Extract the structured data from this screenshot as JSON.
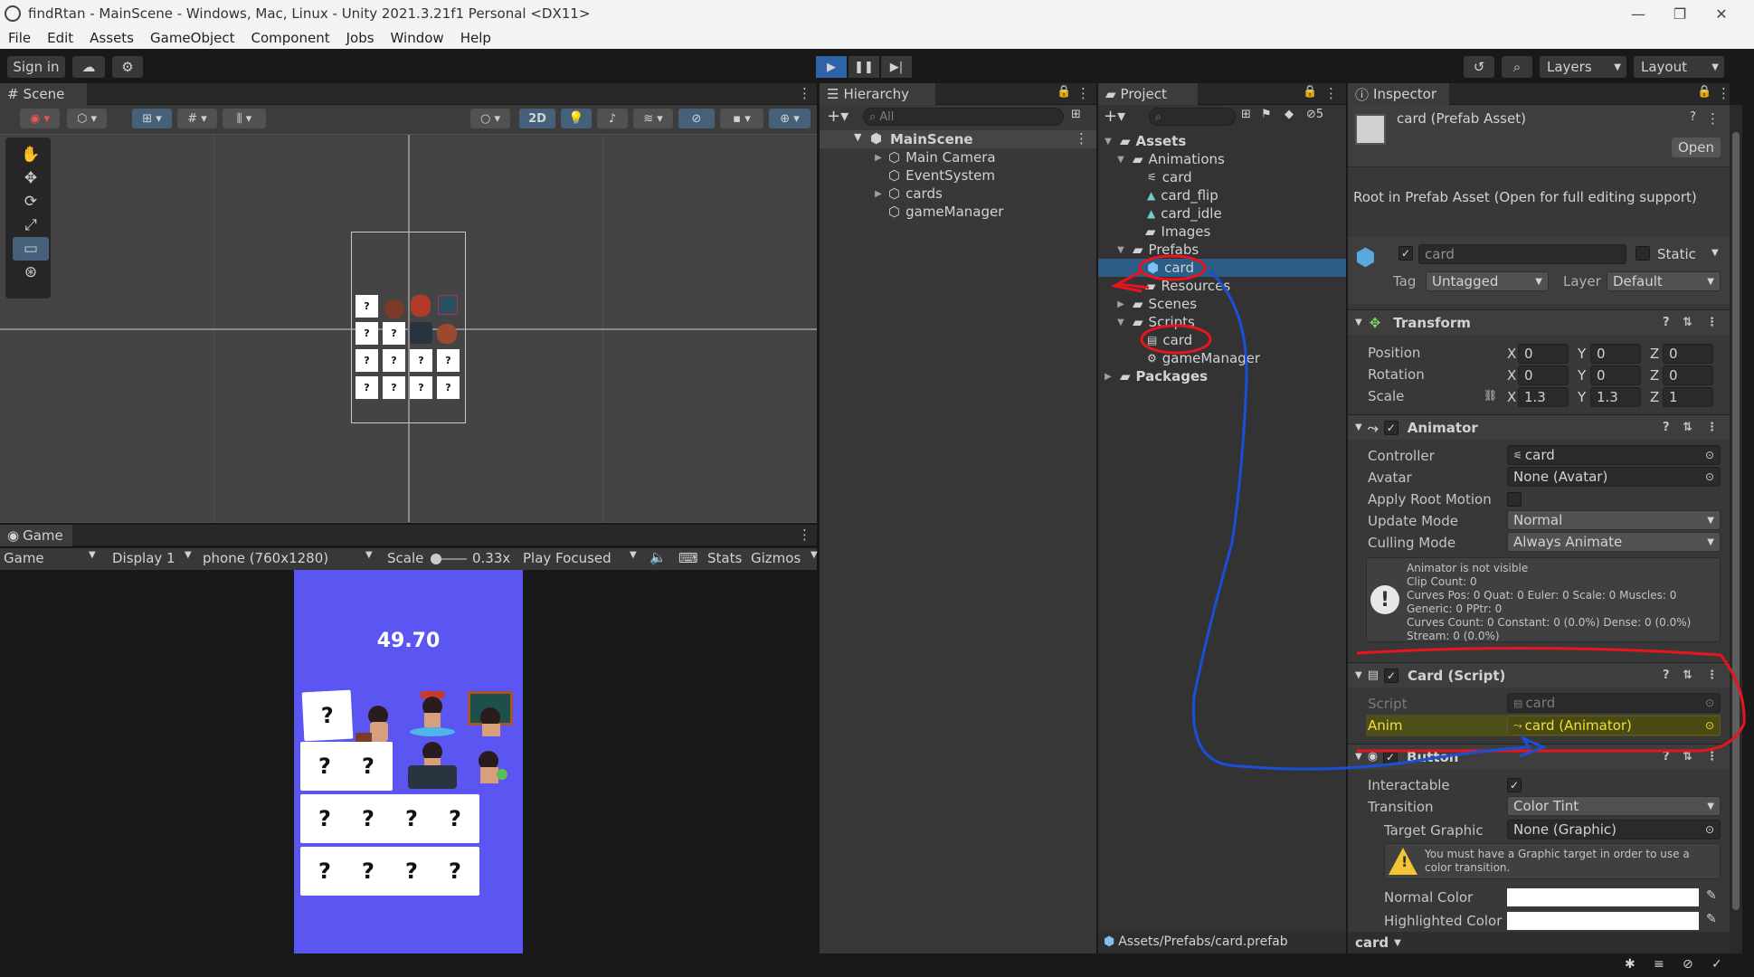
{
  "window": {
    "title": "findRtan - MainScene - Windows, Mac, Linux - Unity 2021.3.21f1 Personal <DX11>",
    "minimize": "—",
    "maximize": "❐",
    "close": "✕"
  },
  "menu": [
    "File",
    "Edit",
    "Assets",
    "GameObject",
    "Component",
    "Jobs",
    "Window",
    "Help"
  ],
  "toolbar": {
    "sign_in": "Sign in",
    "layers": "Layers",
    "layout": "Layout",
    "play_mode_active": true
  },
  "scene": {
    "tab": "Scene",
    "mode_2d": "2D"
  },
  "game": {
    "tab": "Game",
    "view": "Game",
    "display": "Display 1",
    "resolution": "phone (760x1280)",
    "scale_label": "Scale",
    "scale_value": "0.33x",
    "play_focused": "Play Focused",
    "stats": "Stats",
    "gizmos": "Gizmos",
    "timer": "49.70",
    "card_face": "?"
  },
  "hierarchy": {
    "tab": "Hierarchy",
    "search_placeholder": "All",
    "scene": "MainScene",
    "items": [
      "Main Camera",
      "EventSystem",
      "cards",
      "gameManager"
    ]
  },
  "project": {
    "tab": "Project",
    "hidden_count": "5",
    "assets": "Assets",
    "animations": "Animations",
    "anim_items": [
      "card",
      "card_flip",
      "card_idle"
    ],
    "images": "Images",
    "prefabs": "Prefabs",
    "prefab_card": "card",
    "resources": "Resources",
    "scenes": "Scenes",
    "scripts": "Scripts",
    "script_items": [
      "card",
      "gameManager"
    ],
    "packages": "Packages",
    "path": "Assets/Prefabs/card.prefab"
  },
  "inspector": {
    "tab": "Inspector",
    "asset_title": "card (Prefab Asset)",
    "open_button": "Open",
    "root_notice": "Root in Prefab Asset (Open for full editing support)",
    "name_field": "card",
    "static_label": "Static",
    "tag_label": "Tag",
    "tag_value": "Untagged",
    "layer_label": "Layer",
    "layer_value": "Default",
    "transform": {
      "title": "Transform",
      "position_label": "Position",
      "rotation_label": "Rotation",
      "scale_label": "Scale",
      "axis_x": "X",
      "axis_y": "Y",
      "axis_z": "Z",
      "position": [
        "0",
        "0",
        "0"
      ],
      "rotation": [
        "0",
        "0",
        "0"
      ],
      "scale": [
        "1.3",
        "1.3",
        "1"
      ]
    },
    "animator": {
      "title": "Animator",
      "controller_label": "Controller",
      "controller_value": "card",
      "avatar_label": "Avatar",
      "avatar_value": "None (Avatar)",
      "apply_root_label": "Apply Root Motion",
      "update_mode_label": "Update Mode",
      "update_mode_value": "Normal",
      "culling_label": "Culling Mode",
      "culling_value": "Always Animate",
      "info": [
        "Animator is not visible",
        "Clip Count: 0",
        "Curves Pos: 0 Quat: 0 Euler: 0 Scale: 0 Muscles: 0",
        "Generic: 0 PPtr: 0",
        "Curves Count: 0 Constant: 0 (0.0%) Dense: 0 (0.0%)",
        "Stream: 0 (0.0%)"
      ]
    },
    "card_script": {
      "title": "Card (Script)",
      "script_label": "Script",
      "script_value": "card",
      "anim_label": "Anim",
      "anim_value": "card (Animator)"
    },
    "button": {
      "title": "Button",
      "interactable_label": "Interactable",
      "transition_label": "Transition",
      "transition_value": "Color Tint",
      "target_graphic_label": "Target Graphic",
      "target_graphic_value": "None (Graphic)",
      "warning": "You must have a Graphic target in order to use a color transition.",
      "normal_color_label": "Normal Color",
      "highlighted_color_label": "Highlighted Color"
    },
    "footer_label": "card"
  },
  "colors": {
    "selection": "#2c5d87",
    "annotation_red": "#e8141e",
    "annotation_blue": "#1a4fd8",
    "game_background": "#5b55f2"
  }
}
